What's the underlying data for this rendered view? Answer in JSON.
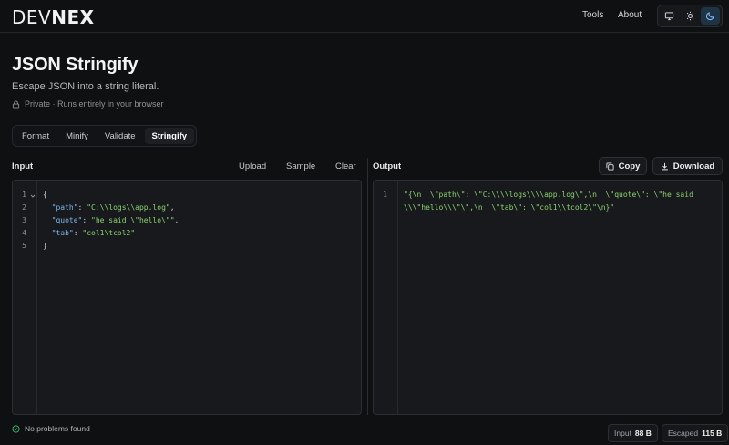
{
  "header": {
    "logo_prefix": "DEV",
    "logo_suffix": "NEX",
    "nav": [
      "Tools",
      "About"
    ],
    "theme_options": [
      "monitor-icon",
      "sun-icon",
      "moon-icon"
    ],
    "theme_active": "moon-icon"
  },
  "page": {
    "title": "JSON Stringify",
    "subtitle": "Escape JSON into a string literal.",
    "privacy": "Private · Runs entirely in your browser"
  },
  "tabs": [
    "Format",
    "Minify",
    "Validate",
    "Stringify"
  ],
  "active_tab": "Stringify",
  "input_panel": {
    "label": "Input",
    "actions": [
      "Upload",
      "Sample",
      "Clear"
    ],
    "line_numbers": [
      "1",
      "2",
      "3",
      "4",
      "5"
    ],
    "lines": [
      {
        "indent": "",
        "key": "",
        "value": "",
        "open": "{",
        "trail": ""
      },
      {
        "indent": "  ",
        "key": "\"path\"",
        "sep": ": ",
        "value": "\"C:\\\\logs\\\\app.log\"",
        "trail": ","
      },
      {
        "indent": "  ",
        "key": "\"quote\"",
        "sep": ": ",
        "value": "\"he said \\\"hello\\\"\"",
        "trail": ","
      },
      {
        "indent": "  ",
        "key": "\"tab\"",
        "sep": ": ",
        "value": "\"col1\\tcol2\"",
        "trail": ""
      },
      {
        "indent": "",
        "key": "",
        "value": "",
        "open": "}",
        "trail": ""
      }
    ]
  },
  "output_panel": {
    "label": "Output",
    "copy_label": "Copy",
    "download_label": "Download",
    "line_numbers": [
      "1"
    ],
    "output_line1": "\"{\\n  \\\"path\\\": \\\"C:\\\\\\\\logs\\\\\\\\app.log\\\",\\n  \\\"quote\\\": \\\"he said",
    "output_line2": "\\\\\\\"hello\\\\\\\"\\\",\\n  \\\"tab\\\": \\\"col1\\\\tcol2\\\"\\n}\""
  },
  "status": {
    "message": "No problems found",
    "input_label": "Input",
    "input_size": "88 B",
    "escaped_label": "Escaped",
    "escaped_size": "115 B"
  },
  "colors": {
    "background": "#0f1012",
    "accent_blue": "#7cb8f0",
    "string_green": "#8bd36f",
    "status_ok": "#3fb56b"
  }
}
